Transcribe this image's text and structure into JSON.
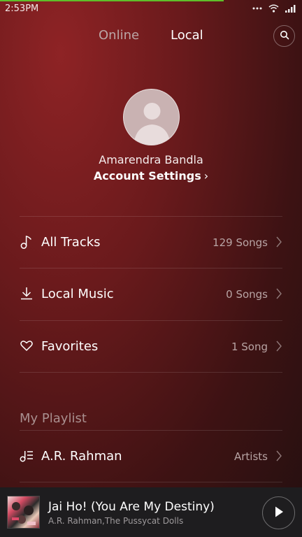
{
  "status_bar": {
    "time": "2:53PM",
    "icons": [
      "more-dots-icon",
      "wifi-icon",
      "signal-icon"
    ],
    "progress_fraction": 0.74
  },
  "header": {
    "tabs": [
      {
        "label": "Online",
        "active": false
      },
      {
        "label": "Local",
        "active": true
      }
    ],
    "search_icon": "search-icon"
  },
  "profile": {
    "user_name": "Amarendra Bandla",
    "account_settings_label": "Account Settings",
    "chevron": "›"
  },
  "library": {
    "items": [
      {
        "label": "All Tracks",
        "count": "129 Songs",
        "icon": "music-note-icon"
      },
      {
        "label": "Local Music",
        "count": "0 Songs",
        "icon": "download-icon"
      },
      {
        "label": "Favorites",
        "count": "1 Song",
        "icon": "heart-icon"
      }
    ]
  },
  "playlist_section": {
    "title": "My Playlist",
    "items": [
      {
        "label": "A.R. Rahman",
        "count": "Artists",
        "icon": "playlist-icon"
      }
    ]
  },
  "now_playing": {
    "title": "Jai Ho! (You Are My Destiny)",
    "artist": "A.R. Rahman,The Pussycat Dolls",
    "play_icon": "play-icon"
  },
  "colors": {
    "background_top": "#8e2325",
    "background_bottom": "#241010",
    "progress": "#5fbf2a",
    "player_bar": "#1e1d1f"
  }
}
